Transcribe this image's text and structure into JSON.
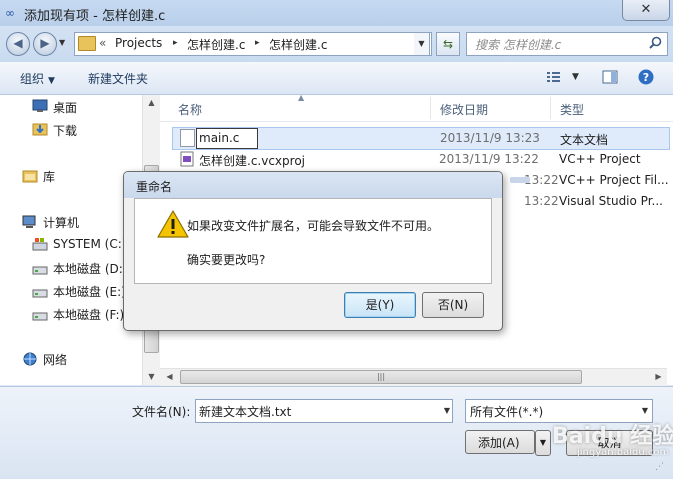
{
  "window": {
    "title": "添加现有项 - 怎样创建.c",
    "close_glyph": "✕"
  },
  "address": {
    "chevrons": "«",
    "segments": [
      "Projects",
      "怎样创建.c",
      "怎样创建.c"
    ],
    "separator": "▸"
  },
  "search": {
    "placeholder": "搜索 怎样创建.c"
  },
  "toolbar": {
    "organize_label": "组织",
    "new_folder_label": "新建文件夹"
  },
  "sidebar": {
    "items": [
      {
        "label": "桌面",
        "icon": "desktop-icon"
      },
      {
        "label": "下载",
        "icon": "downloads-icon"
      },
      {
        "label": "库",
        "icon": "library-icon"
      },
      {
        "label": "计算机",
        "icon": "computer-icon"
      },
      {
        "label": "SYSTEM (C:)",
        "icon": "system-drive-icon"
      },
      {
        "label": "本地磁盘 (D:)",
        "icon": "drive-icon"
      },
      {
        "label": "本地磁盘 (E:)",
        "icon": "drive-icon"
      },
      {
        "label": "本地磁盘 (F:)",
        "icon": "drive-icon"
      },
      {
        "label": "网络",
        "icon": "network-icon"
      }
    ]
  },
  "file_list": {
    "columns": {
      "name": "名称",
      "date": "修改日期",
      "type": "类型"
    },
    "rows": [
      {
        "name": "main.c",
        "date": "2013/11/9 13:23",
        "type": "文本文档"
      },
      {
        "name": "怎样创建.c.vcxproj",
        "date": "2013/11/9 13:22",
        "type": "VC++ Project"
      },
      {
        "name": "",
        "date": "13:22",
        "type": "VC++ Project Fil..."
      },
      {
        "name": "",
        "date": "13:22",
        "type": "Visual Studio Pr..."
      }
    ]
  },
  "bottom": {
    "filename_label": "文件名(N):",
    "filename_value": "新建文本文档.txt",
    "filter_value": "所有文件(*.*)",
    "add_label": "添加(A)",
    "cancel_label": "取消"
  },
  "dialog": {
    "title": "重命名",
    "message": "如果改变文件扩展名，可能会导致文件不可用。",
    "question": "确实要更改吗?",
    "yes_label": "是(Y)",
    "no_label": "否(N)"
  },
  "colors": {
    "accent": "#3c7fb1",
    "selection": "#dfeafb",
    "warning": "#f5c400"
  },
  "watermark": {
    "text": "Baidu 经验",
    "sub": "jingyan.baidu.com"
  }
}
